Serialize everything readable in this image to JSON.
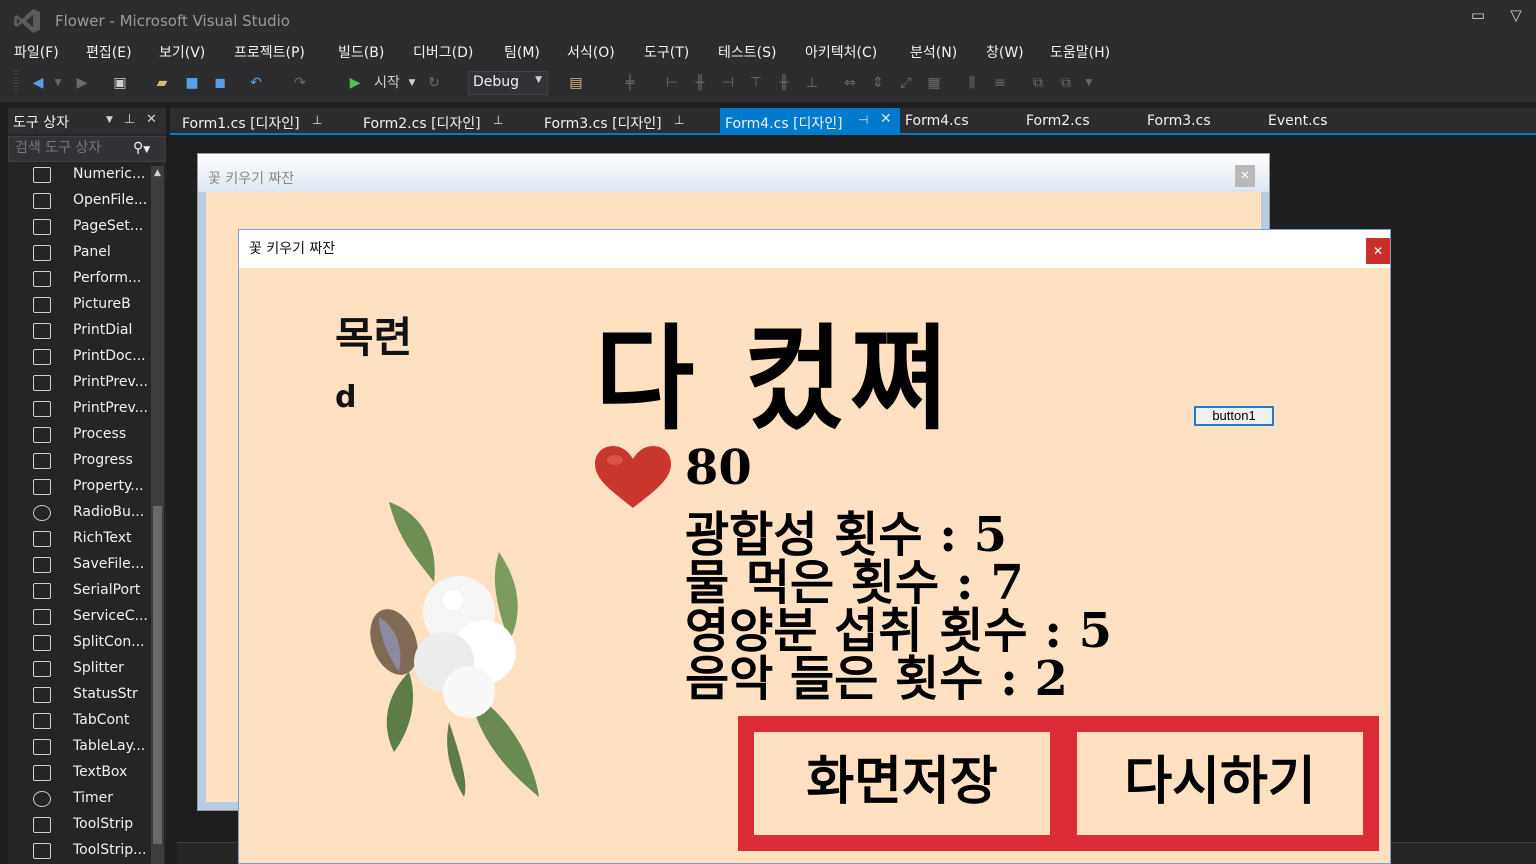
{
  "window": {
    "title": "Flower - Microsoft Visual Studio"
  },
  "menu": [
    {
      "label": "파일(F)"
    },
    {
      "label": "편집(E)"
    },
    {
      "label": "보기(V)"
    },
    {
      "label": "프로젝트(P)"
    },
    {
      "label": "빌드(B)"
    },
    {
      "label": "디버그(D)"
    },
    {
      "label": "팀(M)"
    },
    {
      "label": "서식(O)"
    },
    {
      "label": "도구(T)"
    },
    {
      "label": "테스트(S)"
    },
    {
      "label": "아키텍처(C)"
    },
    {
      "label": "분석(N)"
    },
    {
      "label": "창(W)"
    },
    {
      "label": "도움말(H)"
    }
  ],
  "toolbar": {
    "start_label": "시작",
    "config_value": "Debug"
  },
  "toolbox": {
    "title": "도구 상자",
    "search_placeholder": "검색 도구 상자",
    "items": [
      {
        "label": "Numeric..."
      },
      {
        "label": "OpenFile..."
      },
      {
        "label": "PageSet..."
      },
      {
        "label": "Panel"
      },
      {
        "label": "Perform..."
      },
      {
        "label": "PictureB"
      },
      {
        "label": "PrintDial"
      },
      {
        "label": "PrintDoc..."
      },
      {
        "label": "PrintPrev..."
      },
      {
        "label": "PrintPrev..."
      },
      {
        "label": "Process"
      },
      {
        "label": "Progress"
      },
      {
        "label": "Property..."
      },
      {
        "label": "RadioBu..."
      },
      {
        "label": "RichText"
      },
      {
        "label": "SaveFile..."
      },
      {
        "label": "SerialPort"
      },
      {
        "label": "ServiceC..."
      },
      {
        "label": "SplitCon..."
      },
      {
        "label": "Splitter"
      },
      {
        "label": "StatusStr"
      },
      {
        "label": "TabCont"
      },
      {
        "label": "TableLay..."
      },
      {
        "label": "TextBox"
      },
      {
        "label": "Timer"
      },
      {
        "label": "ToolStrip"
      },
      {
        "label": "ToolStrip..."
      }
    ]
  },
  "tabs": [
    {
      "label": "Form1.cs [디자인]",
      "active": false
    },
    {
      "label": "Form2.cs [디자인]",
      "active": false
    },
    {
      "label": "Form3.cs [디자인]",
      "active": false
    },
    {
      "label": "Form4.cs [디자인]",
      "active": true
    },
    {
      "label": "Form4.cs",
      "active": false
    },
    {
      "label": "Form2.cs",
      "active": false
    },
    {
      "label": "Form3.cs",
      "active": false
    },
    {
      "label": "Event.cs",
      "active": false
    }
  ],
  "background_form": {
    "title": "꽃 키우기 짜잔"
  },
  "form4": {
    "title": "꽃 키우기 짜잔",
    "flower_name": "목련",
    "label_d": "d",
    "headline": "다 컸쪄",
    "button1": "button1",
    "hp": "80",
    "stats": [
      {
        "text": "광합성 횟수 : 5"
      },
      {
        "text": "물 먹은 횟수 : 7"
      },
      {
        "text": "영양분 섭취 횟수 : 5"
      },
      {
        "text": "음악 들은 횟수 : 2"
      }
    ],
    "save_button": "화면저장",
    "retry_button": "다시하기"
  },
  "colors": {
    "accent": "#007acc",
    "form_bg": "#ffe0c0",
    "button_border": "#dc2c36",
    "heart": "#c8362c"
  }
}
